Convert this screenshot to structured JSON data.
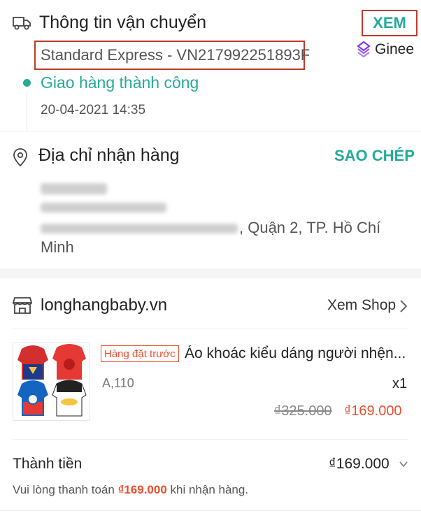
{
  "shipping": {
    "title": "Thông tin vận chuyển",
    "view_label": "XEM",
    "carrier_tracking": "Standard Express - VN217992251893F",
    "status": "Giao hàng thành công",
    "status_time": "20-04-2021 14:35",
    "accent_color": "#26aa99",
    "highlight_color": "#c0392b"
  },
  "watermark": {
    "text": "Ginee"
  },
  "address": {
    "title": "Địa chỉ nhận hàng",
    "copy_label": "SAO CHÉP",
    "line_visible": ", Quận 2, TP. Hồ Chí",
    "line_last": "Minh"
  },
  "shop": {
    "name": "longhangbaby.vn",
    "view_label": "Xem Shop"
  },
  "product": {
    "badge": "Hàng đặt trước",
    "name": "Áo khoác kiểu dáng người nhện...",
    "variant": "A,110",
    "quantity": "x1",
    "original_price": "₫325.000",
    "price": "₫169.000",
    "price_color": "#ee4d2d"
  },
  "total": {
    "label": "Thành tiền",
    "value": "₫169.000",
    "note_prefix": "Vui lòng thanh toán ",
    "note_amount": "₫169.000",
    "note_suffix": " khi nhận hàng."
  },
  "icons": [
    "truck-icon",
    "location-pin-icon",
    "shop-icon",
    "chevron-right-icon",
    "chevron-down-icon",
    "ginee-logo-icon"
  ]
}
